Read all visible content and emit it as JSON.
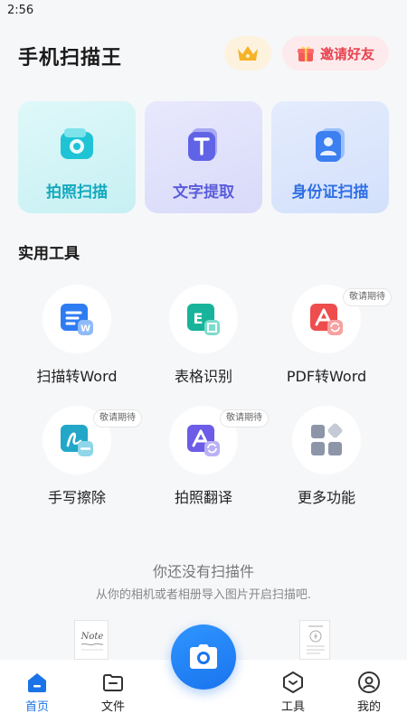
{
  "status_bar": {
    "time": "2:56"
  },
  "header": {
    "title": "手机扫描王",
    "invite_label": "邀请好友",
    "vip_icon": "crown-icon",
    "invite_icon": "gift-icon"
  },
  "features": [
    {
      "label": "拍照扫描",
      "icon": "photo-scan-icon",
      "color": "#12a9bd"
    },
    {
      "label": "文字提取",
      "icon": "text-extract-icon",
      "color": "#5b5cdb"
    },
    {
      "label": "身份证扫描",
      "icon": "id-card-icon",
      "color": "#2f6fe6"
    }
  ],
  "tools_section": {
    "title": "实用工具",
    "items": [
      {
        "label": "扫描转Word",
        "icon": "word-icon",
        "badge": ""
      },
      {
        "label": "表格识别",
        "icon": "excel-icon",
        "badge": ""
      },
      {
        "label": "PDF转Word",
        "icon": "pdf-icon",
        "badge": "敬请期待"
      },
      {
        "label": "手写擦除",
        "icon": "handwriting-erase-icon",
        "badge": "敬请期待"
      },
      {
        "label": "拍照翻译",
        "icon": "translate-icon",
        "badge": "敬请期待"
      },
      {
        "label": "更多功能",
        "icon": "more-grid-icon",
        "badge": ""
      }
    ]
  },
  "empty_state": {
    "title": "你还没有扫描件",
    "subtitle": "从你的相机或者相册导入图片开启扫描吧.",
    "note_text": "Note"
  },
  "bottom_nav": {
    "items": [
      {
        "label": "首页",
        "icon": "home-icon",
        "active": true
      },
      {
        "label": "文件",
        "icon": "folder-icon",
        "active": false
      },
      {
        "label": "工具",
        "icon": "tools-hexagon-icon",
        "active": false
      },
      {
        "label": "我的",
        "icon": "profile-icon",
        "active": false
      }
    ],
    "camera_icon": "camera-icon",
    "accent_color": "#1a73e8"
  }
}
